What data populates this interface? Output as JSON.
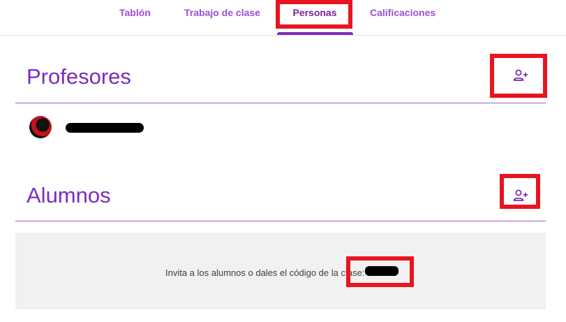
{
  "nav": {
    "tabs": [
      {
        "label": "Tablón"
      },
      {
        "label": "Trabajo de clase"
      },
      {
        "label": "Personas"
      },
      {
        "label": "Calificaciones"
      }
    ],
    "active_tab": "Personas"
  },
  "teachers": {
    "title": "Profesores",
    "add_icon": "person-add-icon"
  },
  "students": {
    "title": "Alumnos",
    "add_icon": "person-add-icon",
    "invite_text": "Invita a los alumnos o dales el código de la clase:"
  },
  "colors": {
    "accent": "#7b2cbf",
    "highlight": "#e8141f"
  }
}
